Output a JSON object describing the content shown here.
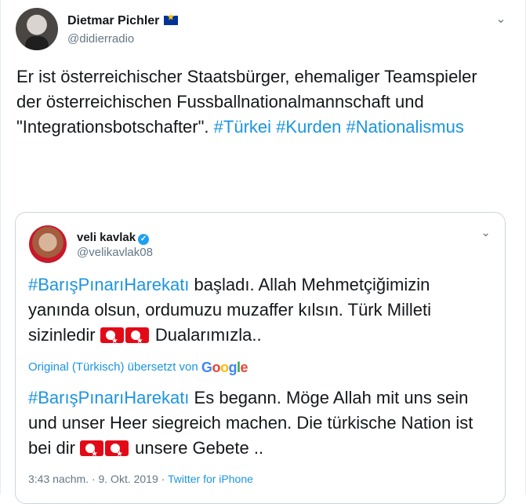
{
  "tweet": {
    "name": "Dietmar Pichler",
    "handle": "@didierradio",
    "text_plain": "Er ist österreichischer Staatsbürger, ehemaliger Teamspieler der österreichischen Fussballnationalmannschaft und \"Integrationsbotschafter\".",
    "hashtags": [
      "#Türkei",
      "#Kurden",
      "#Nationalismus"
    ]
  },
  "quote": {
    "name": "veli kavlak",
    "handle": "@velikavlak08",
    "hashtag": "#BarışPınarıHarekatı",
    "text_1": " başladı. Allah Mehmetçiğimizin yanında olsun, ordumuzu muzaffer kılsın. Türk Milleti sizinledir",
    "text_2": "Dualarımızla..",
    "translated_label": "Original (Türkisch) übersetzt von",
    "google_logo": "Google",
    "t_hashtag": "#BarışPınarıHarekatı",
    "t_text_1": " Es begann. Möge Allah mit uns sein und unser Heer siegreich machen. Die türkische Nation ist bei dir",
    "t_text_2": "unsere Gebete ..",
    "timestamp": "3:43 nachm. · 9. Okt. 2019 ·",
    "source": "Twitter for iPhone"
  }
}
